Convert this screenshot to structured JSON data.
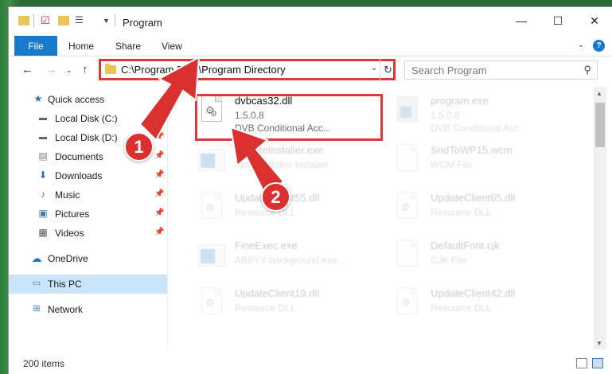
{
  "window": {
    "title": "Program",
    "controls": {
      "minimize": "—",
      "maximize": "☐",
      "close": "✕"
    }
  },
  "ribbon": {
    "tabs": [
      "File",
      "Home",
      "Share",
      "View"
    ],
    "help": "?"
  },
  "address": {
    "path": "C:\\Program Files\\Program Directory",
    "search_placeholder": "Search Program"
  },
  "sidebar": {
    "items": [
      {
        "label": "Quick access",
        "icon": "star-icon"
      },
      {
        "label": "Local Disk (C:)",
        "icon": "drive-icon"
      },
      {
        "label": "Local Disk (D:)",
        "icon": "drive-icon"
      },
      {
        "label": "Documents",
        "icon": "documents-icon"
      },
      {
        "label": "Downloads",
        "icon": "download-icon"
      },
      {
        "label": "Music",
        "icon": "music-icon"
      },
      {
        "label": "Pictures",
        "icon": "pictures-icon"
      },
      {
        "label": "Videos",
        "icon": "videos-icon"
      },
      {
        "label": "OneDrive",
        "icon": "cloud-icon"
      },
      {
        "label": "This PC",
        "icon": "computer-icon"
      },
      {
        "label": "Network",
        "icon": "network-icon"
      }
    ]
  },
  "files": [
    {
      "name": "dvbcas32.dll",
      "line1": "1.5.0.8",
      "line2": "DVB Conditional Acc..."
    },
    {
      "name": "program.exe",
      "line1": "1.5.0.8",
      "line2": "DVB Conditional Acc..."
    },
    {
      "name": "UpdateInstaller.exe",
      "line1": "AbbyUpdates Installer",
      "line2": ""
    },
    {
      "name": "SndToWP15.wcm",
      "line1": "WCM File",
      "line2": ""
    },
    {
      "name": "UpdateClient55.dll",
      "line1": "Resource DLL",
      "line2": ""
    },
    {
      "name": "UpdateClient65.dll",
      "line1": "Resource DLL",
      "line2": ""
    },
    {
      "name": "FineExec.exe",
      "line1": "ABBYY background exe...",
      "line2": ""
    },
    {
      "name": "DefaultFont.cjk",
      "line1": "CJK File",
      "line2": ""
    },
    {
      "name": "UpdateClient19.dll",
      "line1": "Resource DLL",
      "line2": ""
    },
    {
      "name": "UpdateClient42.dll",
      "line1": "Resource DLL",
      "line2": ""
    }
  ],
  "status": {
    "count": "200 items"
  },
  "callouts": {
    "one": "1",
    "two": "2"
  },
  "colors": {
    "accent": "#1979ca",
    "highlight": "#d93a3a",
    "selection": "#cce4f7"
  }
}
